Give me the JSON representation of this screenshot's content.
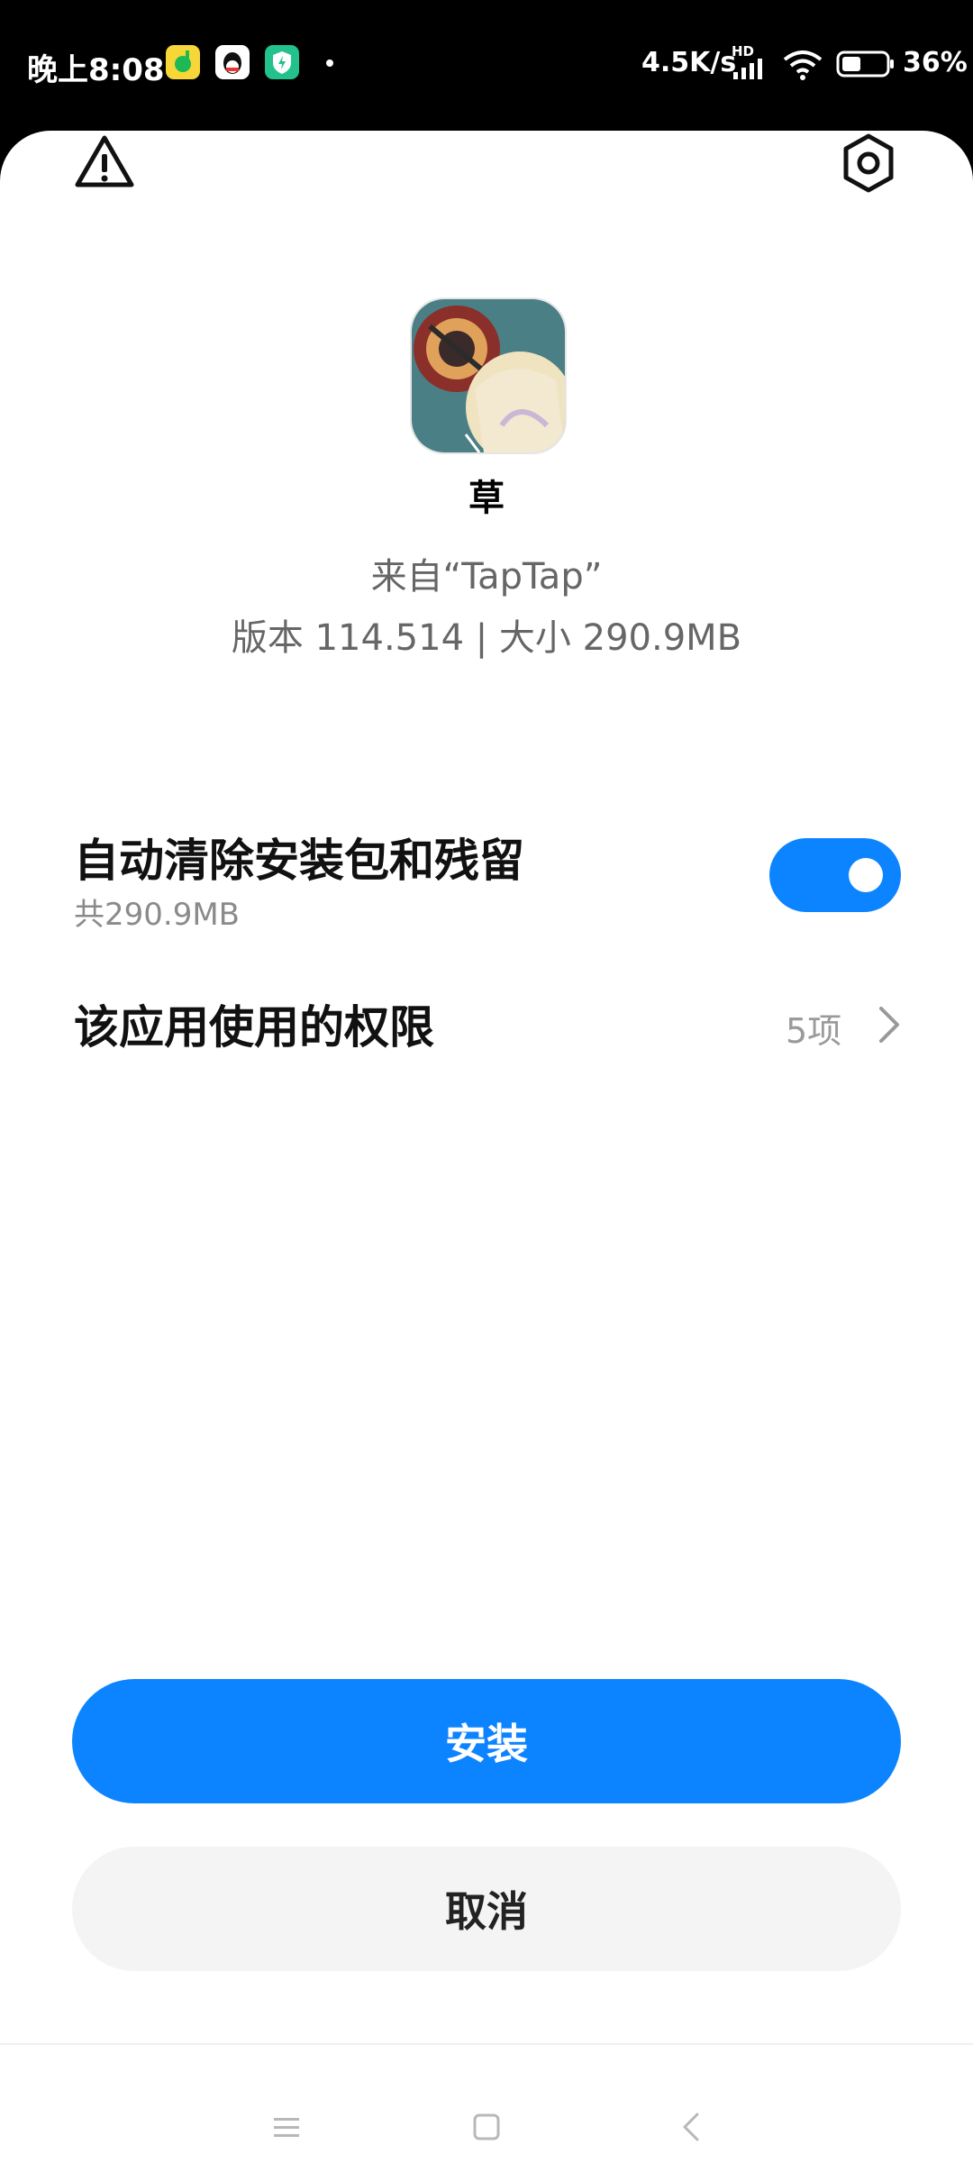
{
  "status_bar": {
    "time": "晚上8:08",
    "net_speed": "4.5K/s",
    "network_badge": "HD",
    "battery": "36%",
    "icons": [
      "music-app-icon",
      "qq-app-icon",
      "security-app-icon",
      "signal-icon",
      "wifi-icon",
      "battery-icon"
    ]
  },
  "header": {
    "warning_icon": "warning-triangle-icon",
    "settings_icon": "gear-icon"
  },
  "app": {
    "name": "草",
    "source": "来自“TapTap”",
    "version_size": "版本 114.514 | 大小 290.9MB"
  },
  "options": {
    "auto_clean": {
      "title": "自动清除安装包和残留",
      "subtitle": "共290.9MB",
      "enabled": true
    },
    "permissions": {
      "title": "该应用使用的权限",
      "count": "5项"
    }
  },
  "buttons": {
    "install": "安装",
    "cancel": "取消"
  },
  "colors": {
    "accent": "#0d84ff",
    "cancel_bg": "#f4f4f4"
  }
}
